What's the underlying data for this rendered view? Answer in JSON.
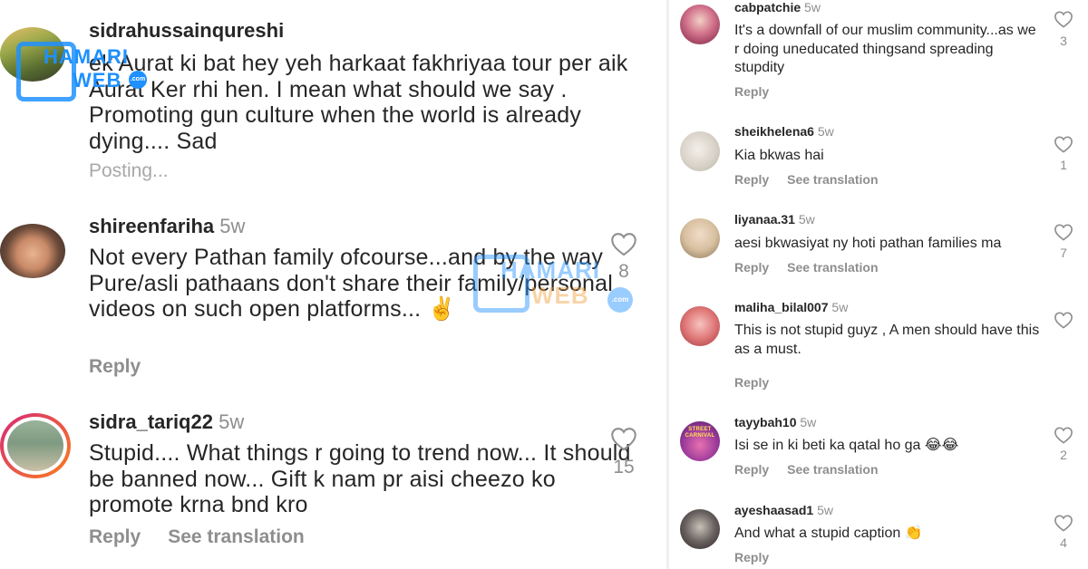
{
  "left": {
    "comments": [
      {
        "username": "sidrahussainqureshi",
        "time": "",
        "text": "ek Aurat ki bat hey yeh harkaat fakhriyaa tour per aik Aurat Ker rhi hen. I mean what should we say .   Promoting gun culture when the world is already dying.... Sad",
        "actions": [
          "Posting..."
        ],
        "likes": ""
      },
      {
        "username": "shireenfariha",
        "time": "5w",
        "text": "Not every Pathan family ofcourse...and by the way Pure/asli pathaans don't share their family/personal videos on such open platforms... ✌️",
        "actions": [
          "Reply"
        ],
        "likes": "8"
      },
      {
        "username": "sidra_tariq22",
        "time": "5w",
        "text": "Stupid.... What things r going to trend now... It should be banned now... Gift k nam pr aisi cheezo ko promote krna bnd kro",
        "actions": [
          "Reply",
          "See translation"
        ],
        "likes": "15"
      }
    ],
    "watermark": {
      "line1": "HAMARI",
      "line2": "WEB",
      "suffix": ".com"
    }
  },
  "right": {
    "comments": [
      {
        "username": "cabpatchie",
        "time": "5w",
        "text": "It's a downfall of our muslim community...as we r doing uneducated thingsand spreading stupdity",
        "actions": [
          "Reply"
        ],
        "likes": "3"
      },
      {
        "username": "sheikhelena6",
        "time": "5w",
        "text": "Kia bkwas hai",
        "actions": [
          "Reply",
          "See translation"
        ],
        "likes": "1"
      },
      {
        "username": "liyanaa.31",
        "time": "5w",
        "text": "aesi bkwasiyat ny hoti pathan families ma",
        "actions": [
          "Reply",
          "See translation"
        ],
        "likes": "7"
      },
      {
        "username": "maliha_bilal007",
        "time": "5w",
        "text": "This is not stupid guyz , A men should have this as a must.",
        "actions": [
          "Reply"
        ],
        "likes": ""
      },
      {
        "username": "tayybah10",
        "time": "5w",
        "text": "Isi se in ki beti ka qatal ho ga 😂😂",
        "actions": [
          "Reply",
          "See translation"
        ],
        "likes": "2"
      },
      {
        "username": "ayeshaasad1",
        "time": "5w",
        "text": "And what a stupid caption 👏",
        "actions": [
          "Reply"
        ],
        "likes": "4"
      }
    ]
  },
  "avatar_badge_text": "STREET CARNIVAL",
  "colors": {
    "text": "#262626",
    "muted": "#8e8e8e",
    "story_ring": "#d62976",
    "watermark_blue": "#1e90ff"
  }
}
